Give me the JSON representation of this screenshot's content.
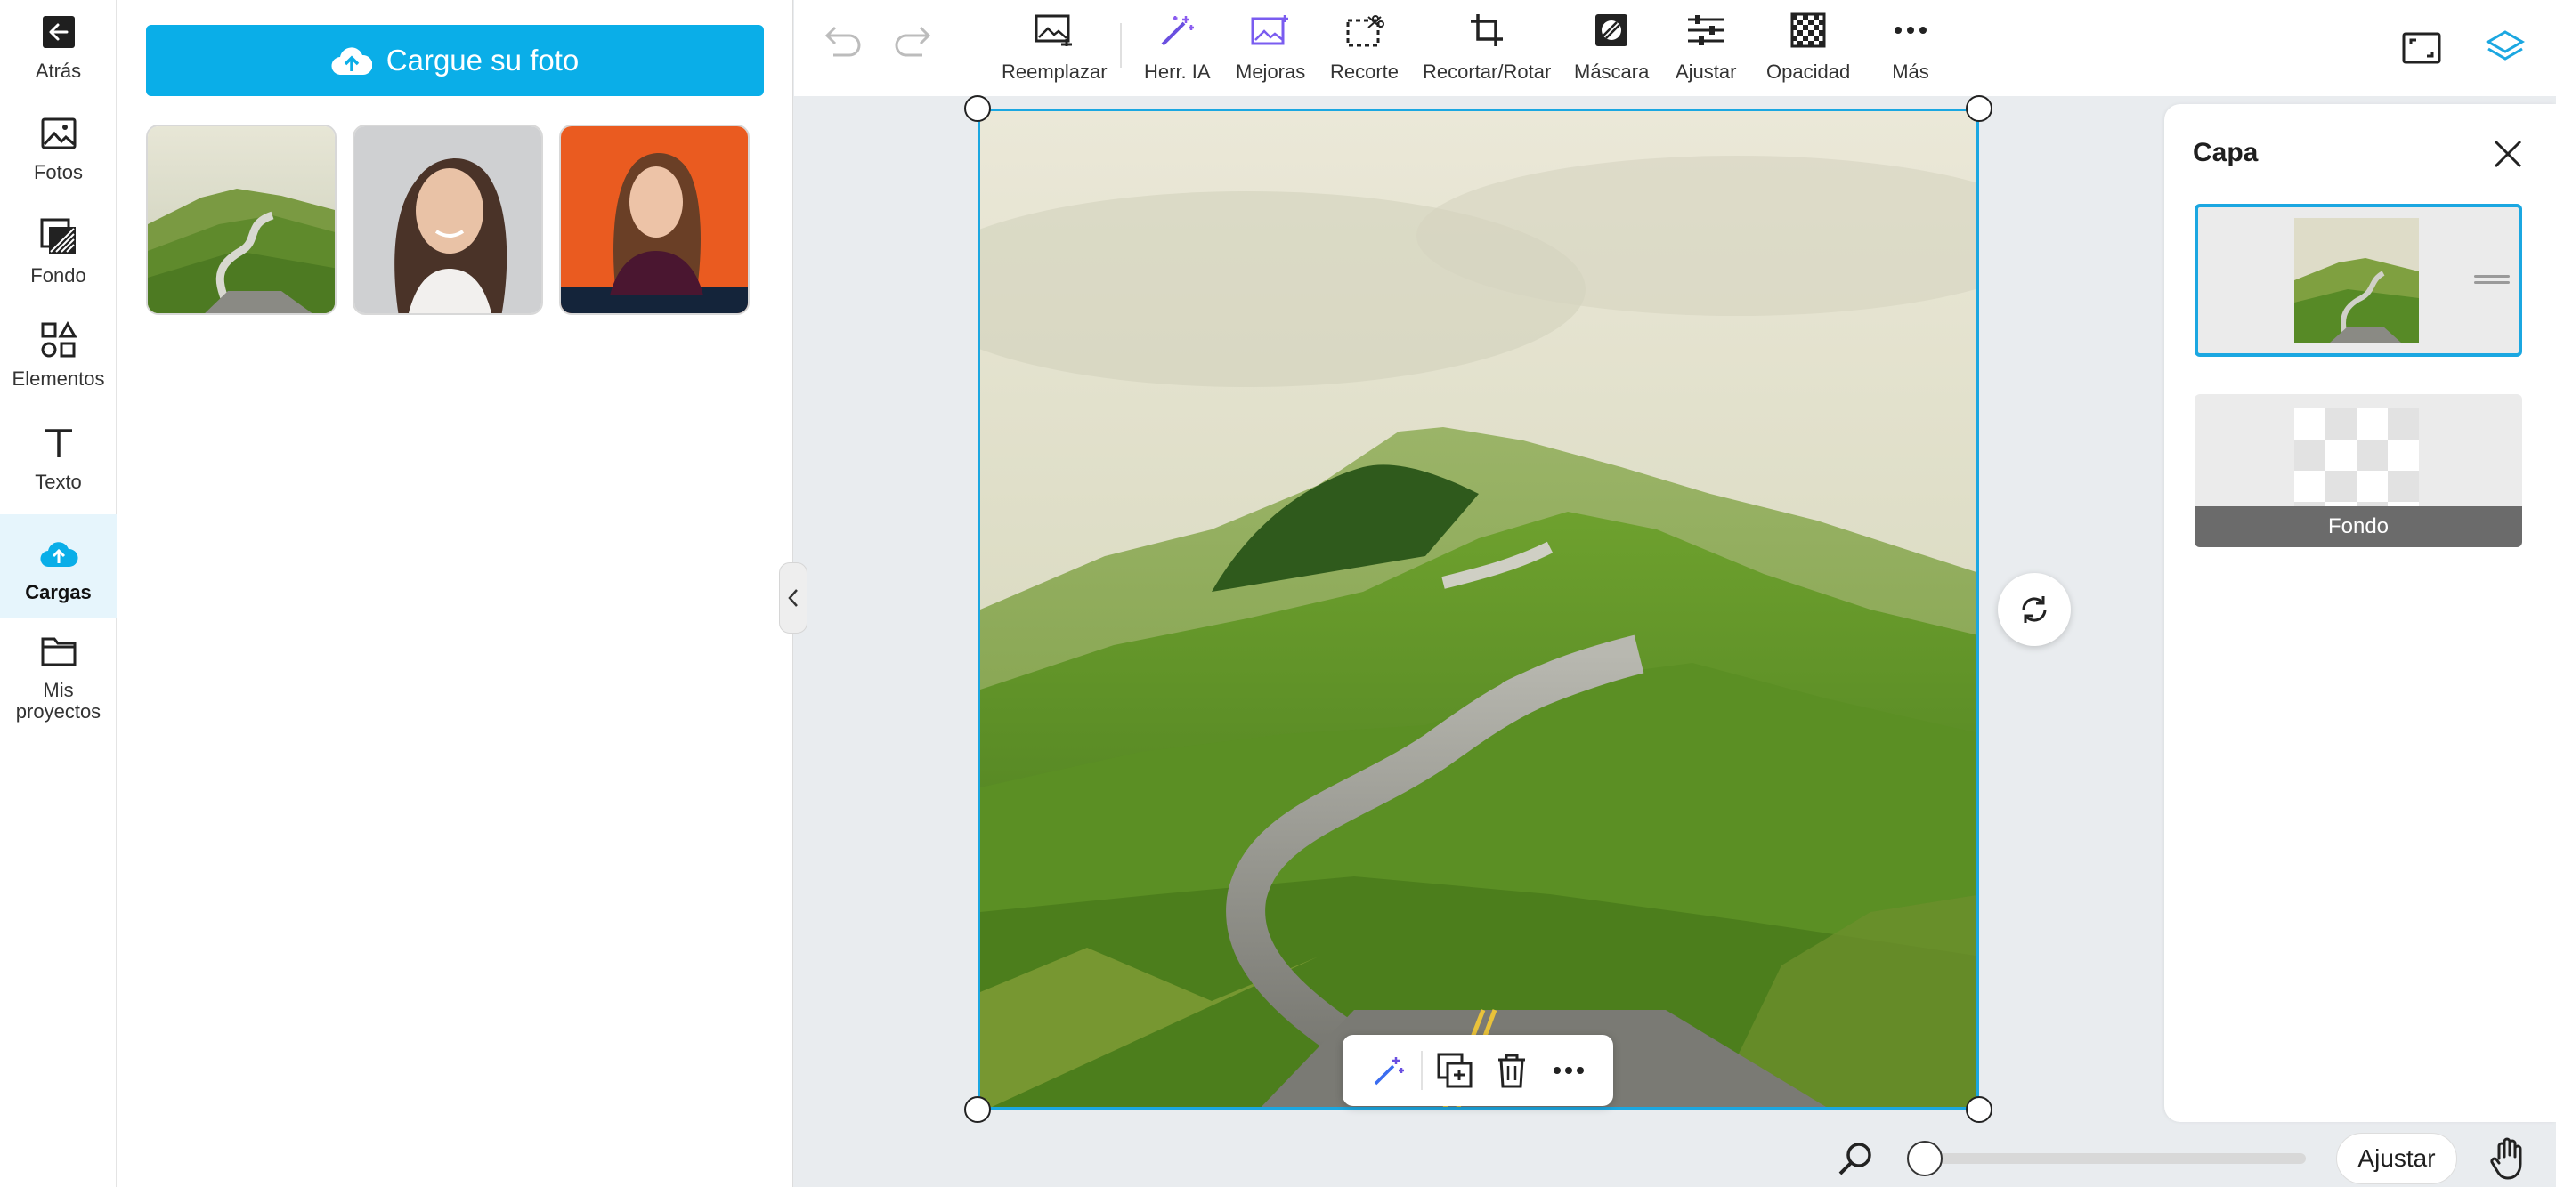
{
  "rail": {
    "items": [
      {
        "label": "Atrás",
        "icon": "arrow-left-icon"
      },
      {
        "label": "Fotos",
        "icon": "image-icon"
      },
      {
        "label": "Fondo",
        "icon": "background-icon"
      },
      {
        "label": "Elementos",
        "icon": "shapes-icon"
      },
      {
        "label": "Texto",
        "icon": "text-icon"
      },
      {
        "label": "Cargas",
        "icon": "cloud-upload-icon",
        "active": true
      },
      {
        "label": "Mis proyectos",
        "icon": "folder-icon"
      }
    ]
  },
  "uploads": {
    "button_label": "Cargue su foto",
    "thumbnails": [
      "landscape-road-photo",
      "woman-portrait-gray-photo",
      "woman-portrait-orange-photo"
    ]
  },
  "toolbar": {
    "undo_icon": "undo-icon",
    "redo_icon": "redo-icon",
    "tools": [
      {
        "label": "Reemplazar",
        "icon": "replace-image-icon"
      },
      {
        "label": "Herr. IA",
        "icon": "magic-wand-icon"
      },
      {
        "label": "Mejoras",
        "icon": "enhance-icon"
      },
      {
        "label": "Recorte",
        "icon": "cutout-icon"
      },
      {
        "label": "Recortar/Rotar",
        "icon": "crop-icon"
      },
      {
        "label": "Máscara",
        "icon": "mask-icon"
      },
      {
        "label": "Ajustar",
        "icon": "sliders-icon"
      },
      {
        "label": "Opacidad",
        "icon": "opacity-icon"
      },
      {
        "label": "Más",
        "icon": "more-icon"
      }
    ],
    "right_icons": [
      "resize-icon",
      "layers-icon"
    ]
  },
  "canvas": {
    "image": "winding-road-green-hills",
    "context_actions": [
      "magic-wand-icon",
      "duplicate-icon",
      "trash-icon",
      "more-icon"
    ]
  },
  "layers_panel": {
    "title": "Capa",
    "layers": [
      {
        "name": "",
        "type": "photo",
        "selected": true
      },
      {
        "name": "Fondo",
        "type": "background",
        "selected": false
      }
    ]
  },
  "zoom": {
    "level": 0.035,
    "fit_label": "Ajustar"
  },
  "colors": {
    "accent": "#1ba7e1",
    "upload_button": "#0aaee8",
    "active_rail_bg": "#e6f5fc",
    "canvas_bg": "#e9ecef"
  }
}
